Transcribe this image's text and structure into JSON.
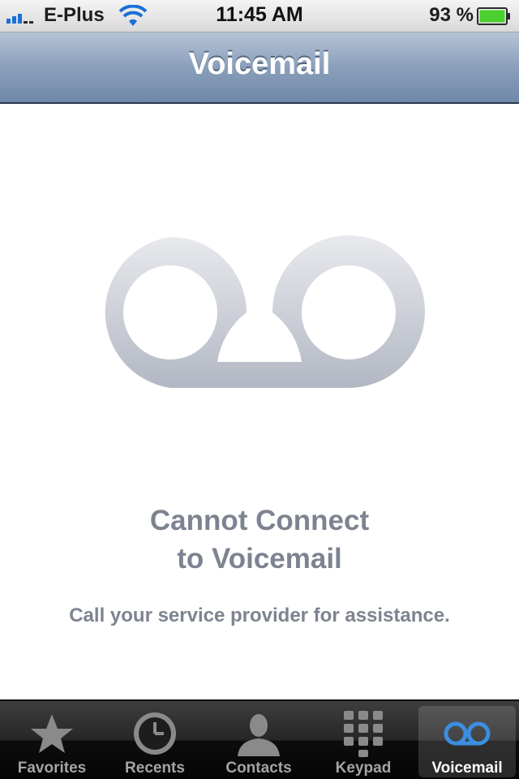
{
  "status_bar": {
    "carrier": "E-Plus",
    "time": "11:45 AM",
    "battery_percent": "93 %",
    "icons": [
      "signal-bars-icon",
      "wifi-icon",
      "battery-icon"
    ]
  },
  "nav": {
    "title": "Voicemail"
  },
  "content": {
    "graphic": "voicemail-icon",
    "error_title_line1": "Cannot Connect",
    "error_title_line2": "to Voicemail",
    "error_subtitle": "Call your service provider for assistance."
  },
  "tab_bar": {
    "tabs": [
      {
        "label": "Favorites",
        "icon": "star-icon"
      },
      {
        "label": "Recents",
        "icon": "clock-icon"
      },
      {
        "label": "Contacts",
        "icon": "person-icon"
      },
      {
        "label": "Keypad",
        "icon": "keypad-icon"
      },
      {
        "label": "Voicemail",
        "icon": "voicemail-icon"
      }
    ],
    "active_tab": "Voicemail"
  },
  "colors": {
    "nav_bar": "#8a9fbb",
    "error_text": "#7d8390",
    "active_tab_icon": "#3b8fe0",
    "battery_fill": "#4cd02f"
  }
}
